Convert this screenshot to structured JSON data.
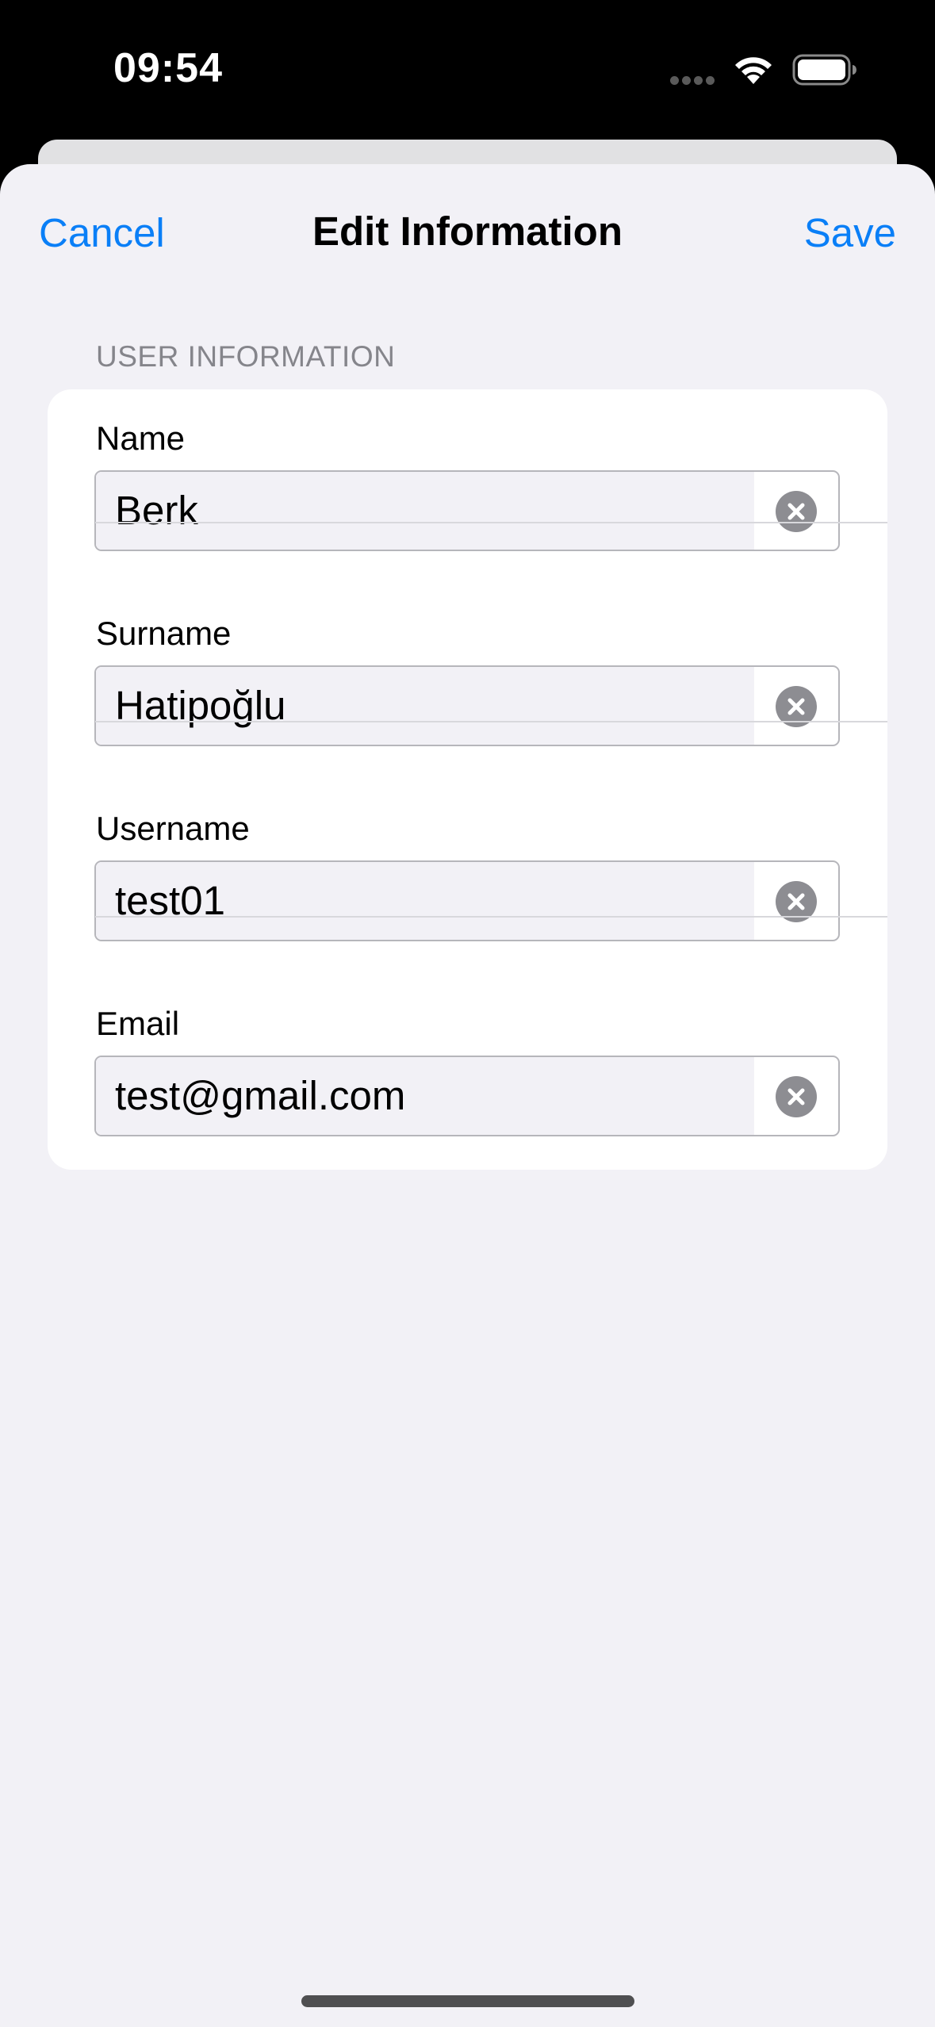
{
  "status_bar": {
    "time": "09:54"
  },
  "nav": {
    "cancel_label": "Cancel",
    "title": "Edit Information",
    "save_label": "Save",
    "accent_color": "#0a7ff7"
  },
  "section": {
    "header": "USER INFORMATION",
    "fields": [
      {
        "label": "Name",
        "value": "Berk"
      },
      {
        "label": "Surname",
        "value": "Hatipoğlu"
      },
      {
        "label": "Username",
        "value": "test01"
      },
      {
        "label": "Email",
        "value": "test@gmail.com"
      }
    ]
  },
  "icons": {
    "clear": "xmark-circle-fill-icon",
    "wifi": "wifi-icon",
    "battery": "battery-full-icon"
  }
}
